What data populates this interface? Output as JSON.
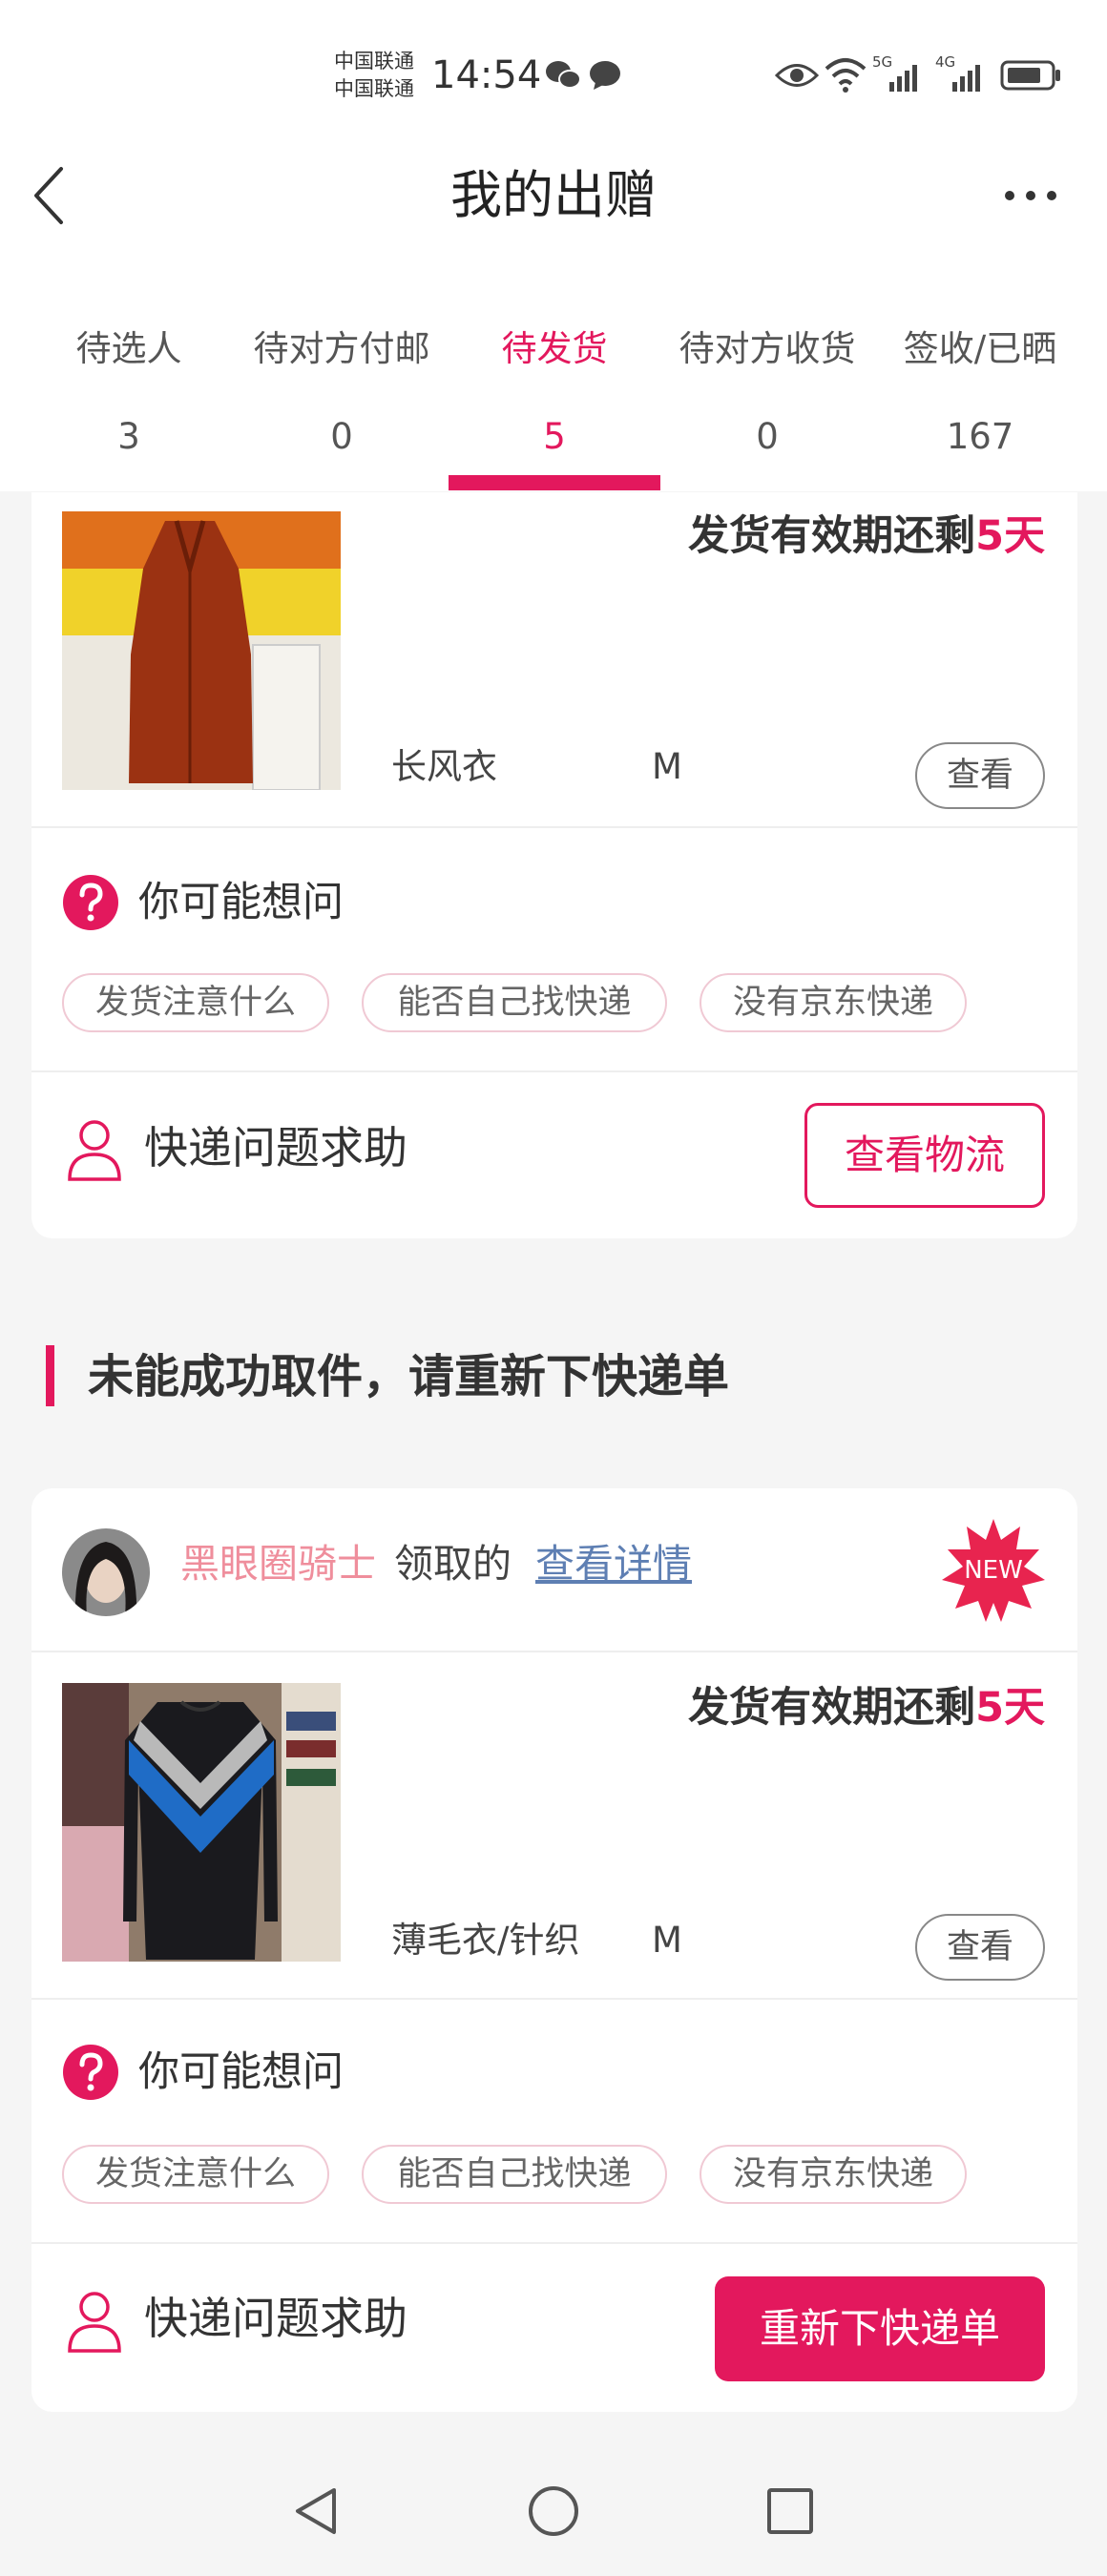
{
  "status_bar": {
    "carrier_1": "中国联通",
    "carrier_2": "中国联通",
    "time": "14:54",
    "network_1": "5G",
    "network_2": "4G"
  },
  "header": {
    "title": "我的出赠"
  },
  "tabs": [
    {
      "label": "待选人",
      "count": "3"
    },
    {
      "label": "待对方付邮",
      "count": "0"
    },
    {
      "label": "待发货",
      "count": "5",
      "active": true
    },
    {
      "label": "待对方收货",
      "count": "0"
    },
    {
      "label": "签收/已晒",
      "count": "167"
    }
  ],
  "card1": {
    "validity_prefix": "发货有效期还剩",
    "validity_days": "5天",
    "item_name": "长风衣",
    "item_size": "M",
    "view_label": "查看",
    "ask_label": "你可能想问",
    "chips": [
      "发货注意什么",
      "能否自己找快递",
      "没有京东快递"
    ],
    "help_label": "快递问题求助",
    "action_label": "查看物流"
  },
  "section": {
    "title": "未能成功取件，请重新下快递单"
  },
  "card2": {
    "claimer_name": "黑眼圈骑士",
    "claim_suffix": "领取的",
    "details_link": "查看详情",
    "badge": "NEW",
    "validity_prefix": "发货有效期还剩",
    "validity_days": "5天",
    "item_name": "薄毛衣/针织",
    "item_size": "M",
    "view_label": "查看",
    "ask_label": "你可能想问",
    "chips": [
      "发货注意什么",
      "能否自己找快递",
      "没有京东快递"
    ],
    "help_label": "快递问题求助",
    "action_label": "重新下快递单"
  },
  "colors": {
    "accent": "#e3185d",
    "claimer_name": "#ef8e9c",
    "link": "#5e7fb3"
  },
  "icons": [
    "back-arrow-icon",
    "more-icon",
    "help-question-icon",
    "person-icon",
    "new-badge-icon",
    "nav-back-icon",
    "nav-home-icon",
    "nav-recents-icon"
  ]
}
